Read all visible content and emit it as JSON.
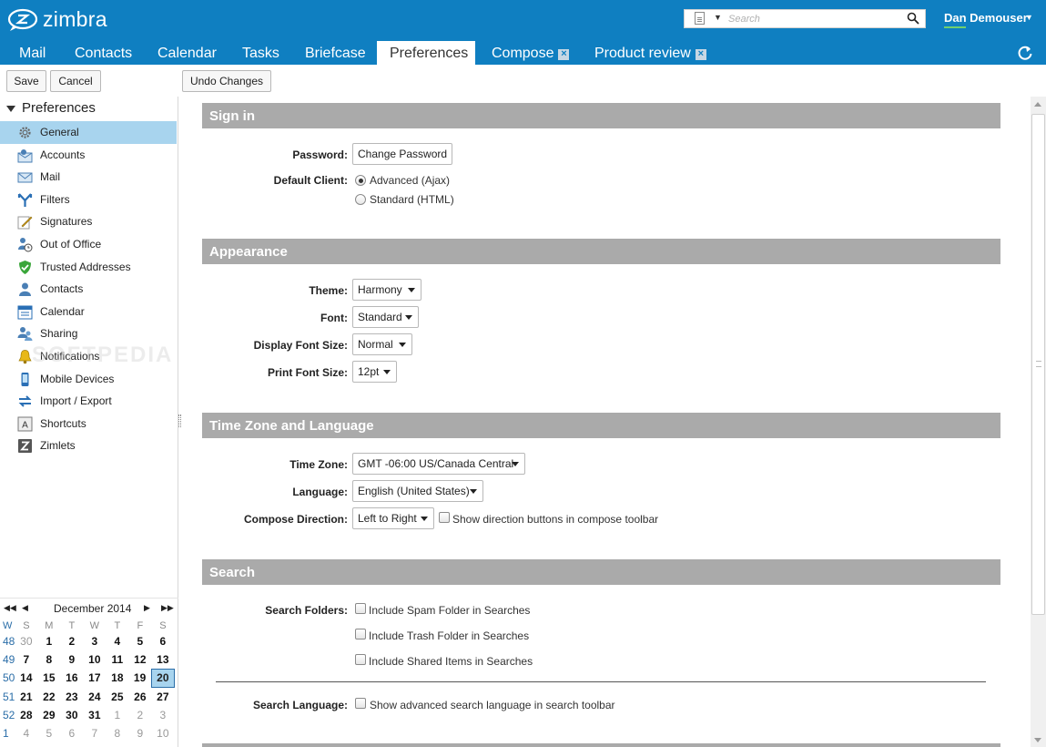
{
  "app": {
    "logo_text": "zimbra"
  },
  "search": {
    "placeholder": "Search"
  },
  "user": {
    "name": "Dan Demouser"
  },
  "tabs": [
    {
      "label": "Mail"
    },
    {
      "label": "Contacts"
    },
    {
      "label": "Calendar"
    },
    {
      "label": "Tasks"
    },
    {
      "label": "Briefcase"
    },
    {
      "label": "Preferences"
    },
    {
      "label": "Compose"
    },
    {
      "label": "Product review"
    }
  ],
  "toolbar": {
    "save_label": "Save",
    "cancel_label": "Cancel",
    "undo_label": "Undo Changes"
  },
  "sidebar": {
    "header": "Preferences",
    "items": [
      {
        "label": "General",
        "icon": "gear-icon"
      },
      {
        "label": "Accounts",
        "icon": "accounts-icon"
      },
      {
        "label": "Mail",
        "icon": "mail-icon"
      },
      {
        "label": "Filters",
        "icon": "filter-icon"
      },
      {
        "label": "Signatures",
        "icon": "signature-icon"
      },
      {
        "label": "Out of Office",
        "icon": "out-of-office-icon"
      },
      {
        "label": "Trusted Addresses",
        "icon": "shield-check-icon"
      },
      {
        "label": "Contacts",
        "icon": "contact-icon"
      },
      {
        "label": "Calendar",
        "icon": "calendar-icon"
      },
      {
        "label": "Sharing",
        "icon": "sharing-icon"
      },
      {
        "label": "Notifications",
        "icon": "bell-icon"
      },
      {
        "label": "Mobile Devices",
        "icon": "mobile-icon"
      },
      {
        "label": "Import / Export",
        "icon": "import-export-icon"
      },
      {
        "label": "Shortcuts",
        "icon": "keyboard-icon"
      },
      {
        "label": "Zimlets",
        "icon": "zimlet-icon"
      }
    ]
  },
  "mini_calendar": {
    "title": "December 2014",
    "weekday_headers": [
      "W",
      "S",
      "M",
      "T",
      "W",
      "T",
      "F",
      "S"
    ],
    "weeks": [
      {
        "wk": "48",
        "days": [
          "30",
          "1",
          "2",
          "3",
          "4",
          "5",
          "6"
        ]
      },
      {
        "wk": "49",
        "days": [
          "7",
          "8",
          "9",
          "10",
          "11",
          "12",
          "13"
        ]
      },
      {
        "wk": "50",
        "days": [
          "14",
          "15",
          "16",
          "17",
          "18",
          "19",
          "20"
        ]
      },
      {
        "wk": "51",
        "days": [
          "21",
          "22",
          "23",
          "24",
          "25",
          "26",
          "27"
        ]
      },
      {
        "wk": "52",
        "days": [
          "28",
          "29",
          "30",
          "31",
          "1",
          "2",
          "3"
        ]
      },
      {
        "wk": "1",
        "days": [
          "4",
          "5",
          "6",
          "7",
          "8",
          "9",
          "10"
        ]
      }
    ],
    "today": "20"
  },
  "sections": {
    "sign_in": {
      "title": "Sign in",
      "password_label": "Password:",
      "change_password": "Change Password",
      "default_client_label": "Default Client:",
      "client_advanced": "Advanced (Ajax)",
      "client_standard": "Standard (HTML)",
      "selected_client": "Advanced (Ajax)"
    },
    "appearance": {
      "title": "Appearance",
      "theme_label": "Theme:",
      "theme_value": "Harmony",
      "font_label": "Font:",
      "font_value": "Standard",
      "display_font_size_label": "Display Font Size:",
      "display_font_size_value": "Normal",
      "print_font_size_label": "Print Font Size:",
      "print_font_size_value": "12pt"
    },
    "timezone_language": {
      "title": "Time Zone and Language",
      "time_zone_label": "Time Zone:",
      "time_zone_value": "GMT -06:00 US/Canada Central",
      "language_label": "Language:",
      "language_value": "English (United States)",
      "compose_direction_label": "Compose Direction:",
      "compose_direction_value": "Left to Right",
      "show_direction_buttons": "Show direction buttons in compose toolbar"
    },
    "search": {
      "title": "Search",
      "search_folders_label": "Search Folders:",
      "include_spam": "Include Spam Folder in Searches",
      "include_trash": "Include Trash Folder in Searches",
      "include_shared": "Include Shared Items in Searches",
      "search_language_label": "Search Language:",
      "show_advanced_search": "Show advanced search language in search toolbar"
    }
  },
  "watermark": "SOFTPEDIA",
  "colors": {
    "brand": "#0f7fc1",
    "section_bar": "#aaaaaa",
    "selection": "#a8d4ee"
  }
}
